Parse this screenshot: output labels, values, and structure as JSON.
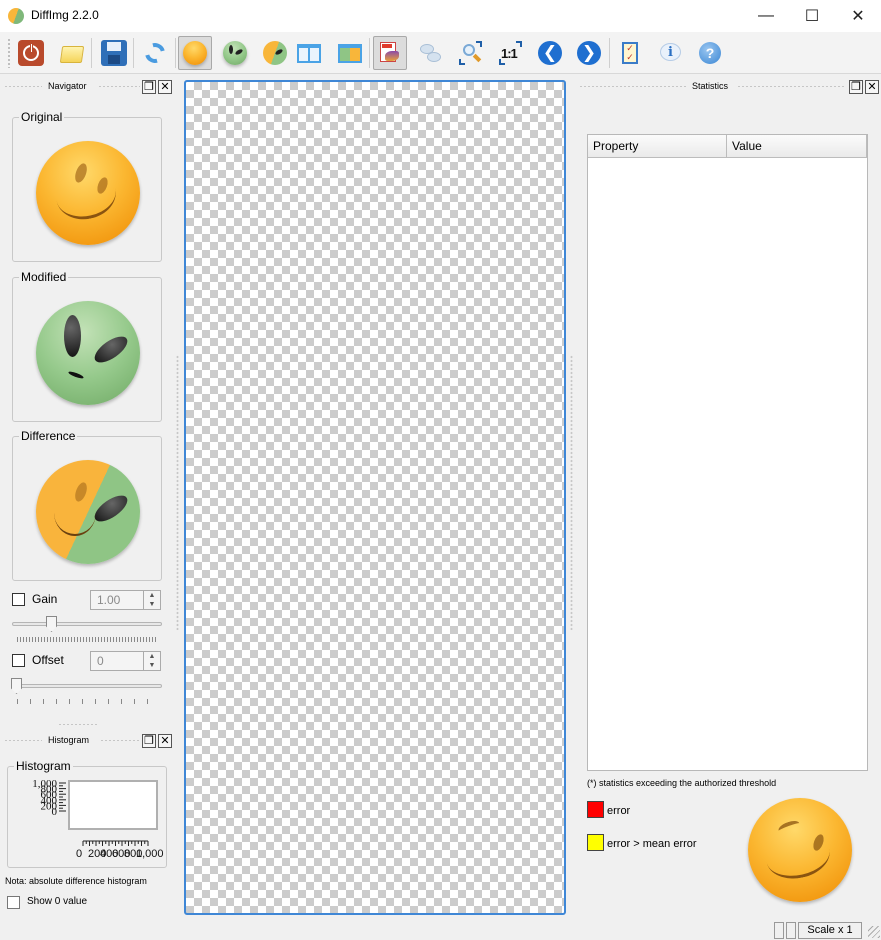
{
  "window": {
    "title": "DiffImg 2.2.0",
    "controls": {
      "minimize": "—",
      "maximize": "☐",
      "close": "✕"
    }
  },
  "toolbar": {
    "buttons": [
      {
        "name": "quit",
        "icon": "power-icon",
        "checked": false
      },
      {
        "name": "open",
        "icon": "folder-icon",
        "checked": false
      },
      {
        "name": "save",
        "icon": "floppy-disk-icon",
        "checked": false
      },
      {
        "name": "refresh",
        "icon": "refresh-icon",
        "checked": false
      },
      {
        "name": "show-original",
        "icon": "smiley-original-icon",
        "checked": true
      },
      {
        "name": "show-modified",
        "icon": "alien-modified-icon",
        "checked": false
      },
      {
        "name": "show-difference",
        "icon": "difference-icon",
        "checked": false
      },
      {
        "name": "dual-view",
        "icon": "split-view-icon",
        "checked": false
      },
      {
        "name": "single-view",
        "icon": "single-view-icon",
        "checked": false
      },
      {
        "name": "show-mask",
        "icon": "mask-icon",
        "checked": true
      },
      {
        "name": "comments",
        "icon": "speech-bubbles-icon",
        "checked": false
      },
      {
        "name": "fit-to-window",
        "icon": "zoom-fit-icon",
        "checked": false
      },
      {
        "name": "original-size",
        "icon": "zoom-1to1-icon",
        "label": "1:1",
        "checked": false
      },
      {
        "name": "previous",
        "icon": "arrow-left-icon",
        "checked": false
      },
      {
        "name": "next",
        "icon": "arrow-right-icon",
        "checked": false
      },
      {
        "name": "preferences",
        "icon": "checklist-icon",
        "checked": false
      },
      {
        "name": "about",
        "icon": "info-icon",
        "checked": false
      },
      {
        "name": "help",
        "icon": "help-icon",
        "checked": false
      }
    ]
  },
  "navigator": {
    "title": "Navigator",
    "original_label": "Original",
    "modified_label": "Modified",
    "difference_label": "Difference",
    "gain": {
      "label": "Gain",
      "checked": false,
      "value": "1.00",
      "slider_fraction": 0.2
    },
    "offset": {
      "label": "Offset",
      "checked": false,
      "value": "0",
      "slider_fraction": 0.0
    }
  },
  "histogram": {
    "dock_title": "Histogram",
    "group_title": "Histogram",
    "note": "Nota: absolute difference histogram",
    "show_zero_label": "Show 0 value",
    "show_zero_checked": false,
    "chart_data": {
      "type": "bar",
      "title": "",
      "xlabel": "",
      "ylabel": "",
      "x_ticks": [
        "0",
        "200",
        "400",
        "600",
        "800",
        "1,000"
      ],
      "y_ticks": [
        "0",
        "200",
        "400",
        "600",
        "800",
        "1,000"
      ],
      "xlim": [
        0,
        1000
      ],
      "ylim": [
        0,
        1000
      ],
      "values": []
    }
  },
  "statistics": {
    "title": "Statistics",
    "columns": [
      "Property",
      "Value"
    ],
    "rows": [],
    "threshold_note": "(*) statistics exceeding the authorized threshold",
    "legend": [
      {
        "label": "error",
        "color": "#ff0000"
      },
      {
        "label": "error > mean error",
        "color": "#ffff00"
      }
    ]
  },
  "statusbar": {
    "scale_label": "Scale x  1"
  }
}
